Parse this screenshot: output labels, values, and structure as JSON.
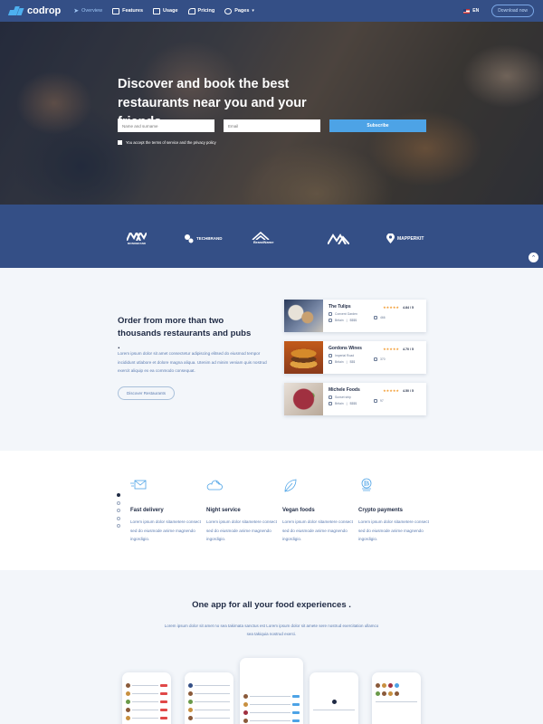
{
  "nav": {
    "brand": "codrop",
    "items": [
      {
        "label": "Overview",
        "icon": "plane-icon",
        "active": true
      },
      {
        "label": "Features",
        "icon": "layout-icon",
        "active": false
      },
      {
        "label": "Usage",
        "icon": "book-icon",
        "active": false
      },
      {
        "label": "Pricing",
        "icon": "tag-icon",
        "active": false
      },
      {
        "label": "Pages",
        "icon": "globe-icon",
        "active": false,
        "dropdown": true
      }
    ],
    "language": "EN",
    "download_label": "Download now"
  },
  "hero": {
    "title": "Discover and book the best restaurants near you and your friends",
    "name_placeholder": "Name and surname",
    "email_placeholder": "Email",
    "subscribe_label": "Subscribe",
    "terms_label": "You accept the terms of service and the privacy policy"
  },
  "brands": [
    {
      "label": "MONOBRAND",
      "icon": "mm-logo"
    },
    {
      "label": "TECHBRAND",
      "icon": "techbrand-logo"
    },
    {
      "label": "BrandName",
      "icon": "house-logo"
    },
    {
      "label": "",
      "icon": "mountain-logo"
    },
    {
      "label": "MAPPERKIT",
      "icon": "pin-logo"
    }
  ],
  "order": {
    "title": "Order from more than two thousands restaurants and pubs .",
    "text": "Lorem ipsum dolor sit amet consectetur adipiscing elitsed do eiusmod tempor incididunt utlabore et dolore magna aliqua. Utenim ad minim veniam quis nostrud exercit aliquip ex ea commodo consequat.",
    "button_label": "Discover Restaurants",
    "restaurants": [
      {
        "name": "The Tulips",
        "rating": "4.84 / 5",
        "location": "Convent Garden",
        "cuisine": "Britain",
        "price": "$$$$",
        "reviews": "466"
      },
      {
        "name": "Gordons Wines",
        "rating": "4.70 / 5",
        "location": "Imperial Road",
        "cuisine": "Britain",
        "price": "$$$",
        "reviews": "370"
      },
      {
        "name": "Michele Foods",
        "rating": "4.50 / 5",
        "location": "Sunset strip",
        "cuisine": "Britain",
        "price": "$$$$",
        "reviews": "97"
      }
    ]
  },
  "features": [
    {
      "title": "Fast delivery",
      "icon": "delivery-icon",
      "text": "Lorem ipsum dolor sitametere consect sed do eiusmode anime magnendo ingordigio."
    },
    {
      "title": "Night service",
      "icon": "moon-cloud-icon",
      "text": "Lorem ipsum dolor sitametere consect sed do eiusmode anime magnendo ingordigio."
    },
    {
      "title": "Vegan foods",
      "icon": "leaf-icon",
      "text": "Lorem ipsum dolor sitametere consect sed do eiusmode anime magnendo ingordigio."
    },
    {
      "title": "Crypto payments",
      "icon": "coin-icon",
      "text": "Lorem ipsum dolor sitametere consect sed do eiusmode anime magnendo ingordigio."
    }
  ],
  "app": {
    "title": "One app for all your food experiences .",
    "text": "Lorem ipsum dolor sit amet no sea takimata sanctus est Lorem ipsum dolor sit amete sere nostrud exercitation ullamco sea takiquia nostrud exerci."
  },
  "colors": {
    "primary": "#344f86",
    "accent": "#4da3e6",
    "star": "#f29a2e",
    "dark_text": "#1f2a44",
    "muted_text": "#5b7bb0"
  }
}
